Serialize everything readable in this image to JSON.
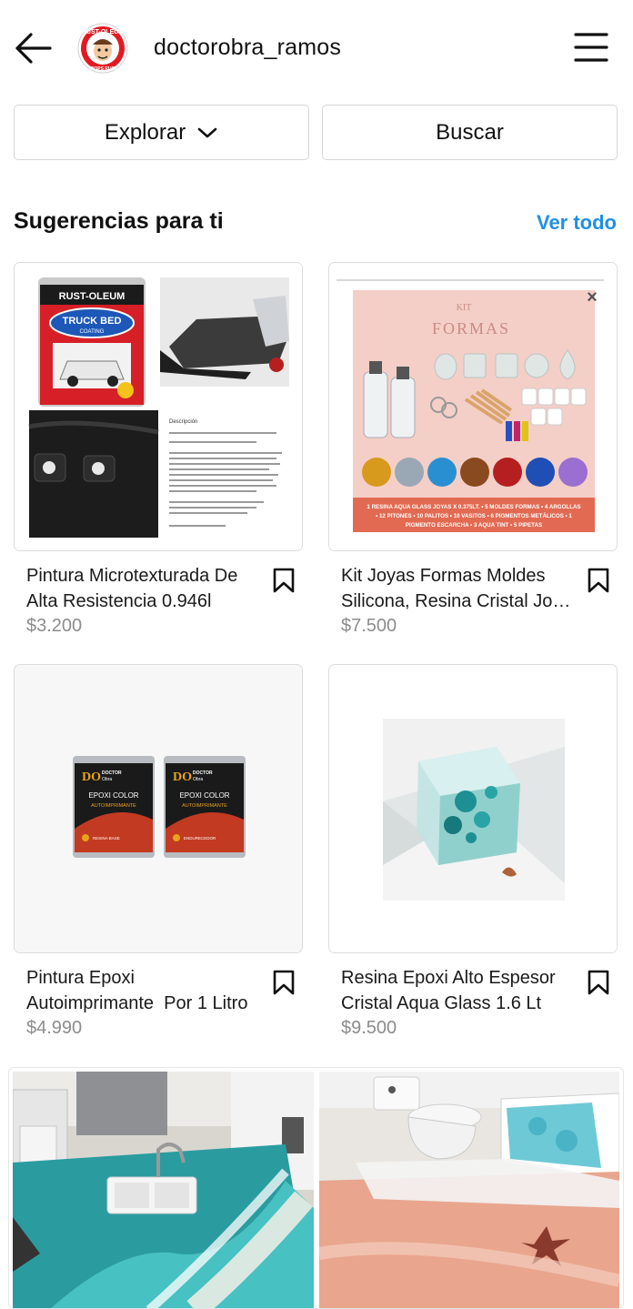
{
  "header": {
    "username": "doctorobra_ramos",
    "avatar_brand_top": "RUST-OLEUM",
    "avatar_brand_bottom": "STOPS RUST"
  },
  "actions": {
    "explore_label": "Explorar",
    "search_label": "Buscar"
  },
  "suggestions": {
    "title": "Sugerencias para ti",
    "see_all": "Ver todo",
    "accent_color": "#1f8fe6",
    "products": [
      {
        "title_line1": "Pintura Microtexturada De",
        "title_line2": "Alta Resistencia 0.946l",
        "price": "$3.200",
        "img": {
          "brand": "RUST-OLEUM",
          "product": "TRUCK BED",
          "sub": "COATING",
          "desc_head": "Descripción"
        }
      },
      {
        "title_line1": "Kit Joyas Formas Moldes",
        "title_line2": "Silicona, Resina Cristal Jo…",
        "price": "$7.500",
        "img": {
          "kit": "KIT",
          "heading": "FORMAS",
          "close": "×",
          "banner1": "1 RESINA AQUA GLASS JOYAS X 0.375LT. • 5 MOLDES FORMAS • 4 ARGOLLAS",
          "banner2": "• 12 PITONES • 10 PALITOS • 10 VASITOS • 6 PIGMENTOS METÁLICOS • 1",
          "banner3": "PIGMENTO ESCARCHA • 3 AQUA TINT • 5 PIPETAS"
        }
      },
      {
        "title_line1": "Pintura Epoxi",
        "title_line2": "Autoimprimante  Por 1 Litro",
        "price": "$4.990",
        "img": {
          "brand": "DO",
          "brand_sub1": "DOCTOR",
          "brand_sub2": "Obra",
          "line1": "EPOXI COLOR",
          "line2": "AUTOIMPRIMANTE",
          "can1": "RESINA BASE",
          "can2": "ENDURECEDOR"
        }
      },
      {
        "title_line1": "Resina Epoxi Alto Espesor",
        "title_line2": "Cristal Aqua Glass 1.6 Lt",
        "price": "$9.500"
      }
    ]
  },
  "bottom_gallery": [
    "kitchen-ocean-epoxy-counter",
    "bathroom-epoxy-floor"
  ]
}
